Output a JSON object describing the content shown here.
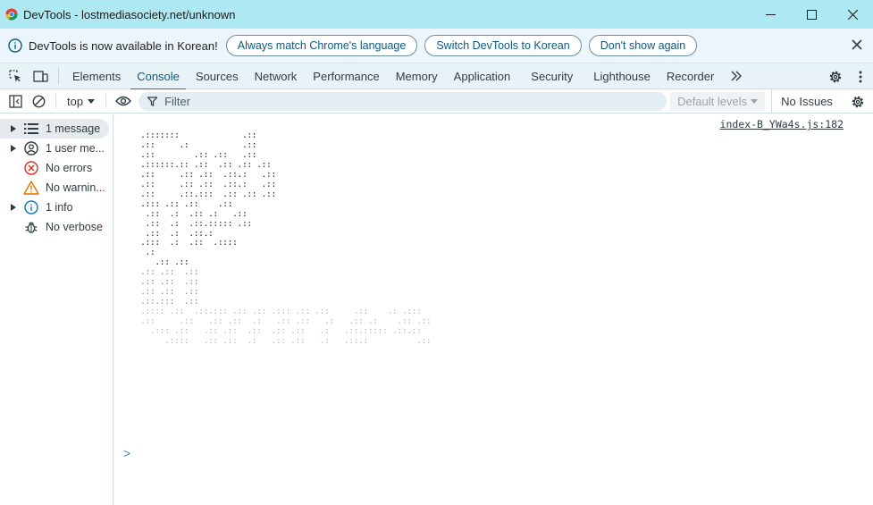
{
  "window": {
    "title": "DevTools - lostmediasociety.net/unknown",
    "controls": [
      "minimize",
      "maximize",
      "close"
    ]
  },
  "infobar": {
    "message": "DevTools is now available in Korean!",
    "buttons": [
      "Always match Chrome's language",
      "Switch DevTools to Korean",
      "Don't show again"
    ]
  },
  "tabs": {
    "items": [
      "Elements",
      "Console",
      "Sources",
      "Network",
      "Performance",
      "Memory",
      "Application",
      "Security",
      "Lighthouse",
      "Recorder"
    ],
    "active": "Console",
    "more": ">>"
  },
  "console_toolbar": {
    "context": "top",
    "filter_placeholder": "Filter",
    "levels": "Default levels",
    "issues": "No Issues"
  },
  "sidebar": {
    "items": [
      {
        "label": "1 message",
        "icon": "list-icon",
        "expandable": true,
        "selected": true
      },
      {
        "label": "1 user me...",
        "icon": "user-icon",
        "expandable": true,
        "selected": false
      },
      {
        "label": "No errors",
        "icon": "error-icon",
        "expandable": false,
        "selected": false
      },
      {
        "label": "No warnin...",
        "icon": "warning-icon",
        "expandable": false,
        "selected": false
      },
      {
        "label": "1 info",
        "icon": "info-icon",
        "expandable": true,
        "selected": false
      },
      {
        "label": "No verbose",
        "icon": "bug-icon",
        "expandable": false,
        "selected": false
      }
    ]
  },
  "console": {
    "source": "index-B_YWa4s.js:182",
    "output_lines": [
      ".:::::::             .::",
      ".::     .:           .::",
      ".::        .:: .::   .::",
      ".::::::.:: .::  .:: .:: .::",
      ".::     .:: .::  .::.:   .::",
      ".::     .:: .::  .::.:   .::",
      ".::     .::.:::  .:: .:: .::",
      ".::: .:: .::    .::",
      " .::  .:  .:: .:   .::",
      " .::  .:  .::.::::: .::",
      " .::  .:  .::.:",
      ".:::  .:  .::  .::::",
      " .:",
      "   .:: .::",
      ".:: .::  .::",
      ".:: .::  .::",
      ".:: .::  .::",
      ".::.:::  .::",
      ".:::: .::  .::.::: .:: .:: .::: .:: .::     .::    .: .:::",
      ".::     .::   .:: .::  .:   .:: .::   .:   .:: .:    .:: .::",
      "  .::: .::   .:: .::  .::  .:: .::   .:   .::.::::: .::.::",
      "     .::::   .:: .::  .:   .:: .::   .:   .::.:          .::"
    ],
    "prompt": ">"
  },
  "colors": {
    "titlebar": "#aee8f2",
    "accent": "#0b7bb0",
    "error": "#d93025",
    "warning": "#e37400",
    "info": "#0b7bb0"
  }
}
